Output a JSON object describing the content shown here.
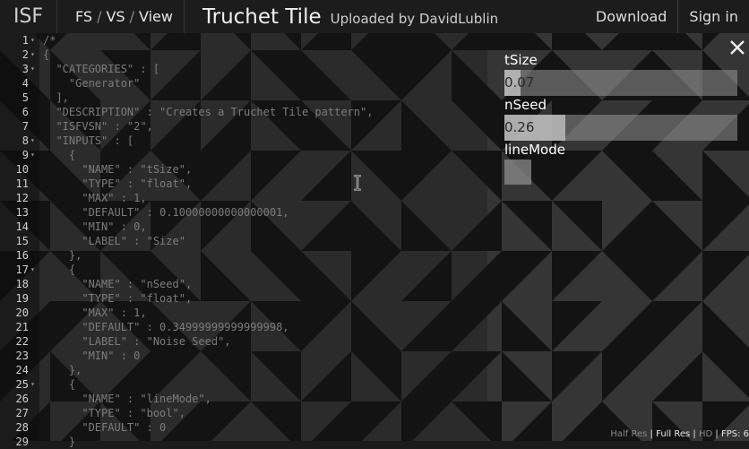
{
  "header": {
    "logo": "ISF",
    "nav": [
      "FS",
      "VS",
      "View"
    ],
    "nav_sep": "/",
    "title": "Truchet Tile",
    "uploader": "Uploaded by DavidLublin",
    "download": "Download",
    "signin": "Sign in"
  },
  "editor": {
    "lines": [
      {
        "n": "1",
        "fold": true,
        "text": "/*"
      },
      {
        "n": "2",
        "fold": true,
        "text": "{"
      },
      {
        "n": "3",
        "fold": true,
        "text": "  \"CATEGORIES\" : ["
      },
      {
        "n": "4",
        "fold": false,
        "text": "    \"Generator\""
      },
      {
        "n": "5",
        "fold": false,
        "text": "  ],"
      },
      {
        "n": "6",
        "fold": false,
        "text": "  \"DESCRIPTION\" : \"Creates a Truchet Tile pattern\","
      },
      {
        "n": "7",
        "fold": false,
        "text": "  \"ISFVSN\" : \"2\","
      },
      {
        "n": "8",
        "fold": true,
        "text": "  \"INPUTS\" : ["
      },
      {
        "n": "9",
        "fold": true,
        "text": "    {"
      },
      {
        "n": "10",
        "fold": false,
        "text": "      \"NAME\" : \"tSize\","
      },
      {
        "n": "11",
        "fold": false,
        "text": "      \"TYPE\" : \"float\","
      },
      {
        "n": "12",
        "fold": false,
        "text": "      \"MAX\" : 1,"
      },
      {
        "n": "13",
        "fold": false,
        "text": "      \"DEFAULT\" : 0.10000000000000001,"
      },
      {
        "n": "14",
        "fold": false,
        "text": "      \"MIN\" : 0,"
      },
      {
        "n": "15",
        "fold": false,
        "text": "      \"LABEL\" : \"Size\""
      },
      {
        "n": "16",
        "fold": false,
        "text": "    },"
      },
      {
        "n": "17",
        "fold": true,
        "text": "    {"
      },
      {
        "n": "18",
        "fold": false,
        "text": "      \"NAME\" : \"nSeed\","
      },
      {
        "n": "19",
        "fold": false,
        "text": "      \"TYPE\" : \"float\","
      },
      {
        "n": "20",
        "fold": false,
        "text": "      \"MAX\" : 1,"
      },
      {
        "n": "21",
        "fold": false,
        "text": "      \"DEFAULT\" : 0.34999999999999998,"
      },
      {
        "n": "22",
        "fold": false,
        "text": "      \"LABEL\" : \"Noise Seed\","
      },
      {
        "n": "23",
        "fold": false,
        "text": "      \"MIN\" : 0"
      },
      {
        "n": "24",
        "fold": false,
        "text": "    },"
      },
      {
        "n": "25",
        "fold": true,
        "text": "    {"
      },
      {
        "n": "26",
        "fold": false,
        "text": "      \"NAME\" : \"lineMode\","
      },
      {
        "n": "27",
        "fold": false,
        "text": "      \"TYPE\" : \"bool\","
      },
      {
        "n": "28",
        "fold": false,
        "text": "      \"DEFAULT\" : 0"
      },
      {
        "n": "29",
        "fold": false,
        "text": "    }"
      }
    ]
  },
  "panel": {
    "close_icon": "close-icon",
    "tsize": {
      "label": "tSize",
      "value": "0.07",
      "fraction": 0.07
    },
    "nseed": {
      "label": "nSeed",
      "value": "0.26",
      "fraction": 0.26
    },
    "linemode": {
      "label": "lineMode",
      "checked": false
    }
  },
  "footer": {
    "half_res": "Half Res",
    "sep1": " | ",
    "full_res": "Full Res",
    "sep2": " | ",
    "hd": "HD",
    "sep3": " | ",
    "fps": "FPS: 6"
  },
  "colors": {
    "fold_marker": "#9a9a9a",
    "line_number": "#d0d0d0",
    "code_text": "#7c7c7c"
  }
}
